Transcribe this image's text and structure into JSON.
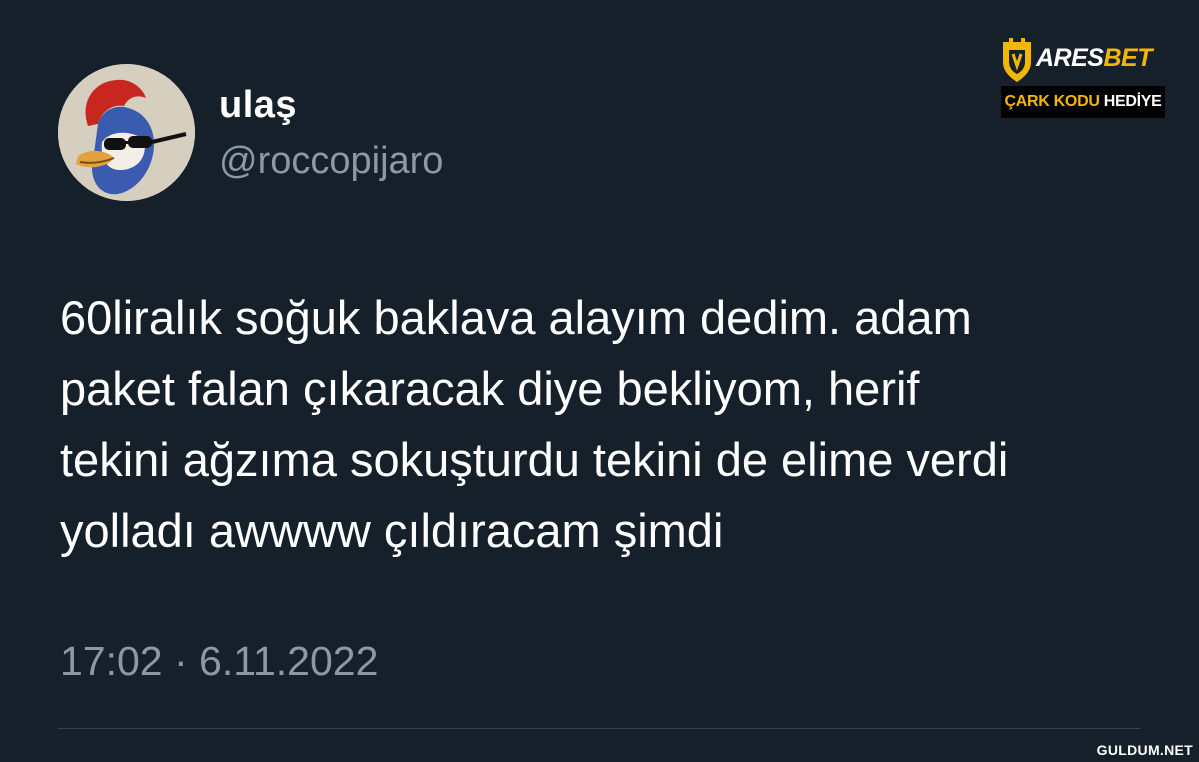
{
  "tweet": {
    "avatar_icon": "woody-woodpecker-avatar-icon",
    "display_name": "ulaş",
    "handle": "@roccopijaro",
    "text_lines": [
      "60liralık soğuk baklava alayım dedim. adam",
      "paket falan çıkaracak diye bekliyom, herif",
      "tekini ağzıma sokuşturdu tekini de elime verdi",
      "yolladı awwww çıldıracam şimdi"
    ],
    "timestamp": "17:02 · 6.11.2022"
  },
  "ad": {
    "logo_icon": "shield-logo-icon",
    "brand_main": "ARES",
    "brand_accent": "BET",
    "badge_accent": "ÇARK KODU",
    "badge_main": " HEDİYE"
  },
  "watermark": "GULDUM.NET",
  "colors": {
    "background": "#15202b",
    "text": "#ffffff",
    "secondary_text": "#8b98a5",
    "divider": "#38444d",
    "ad_accent": "#f2b705"
  }
}
